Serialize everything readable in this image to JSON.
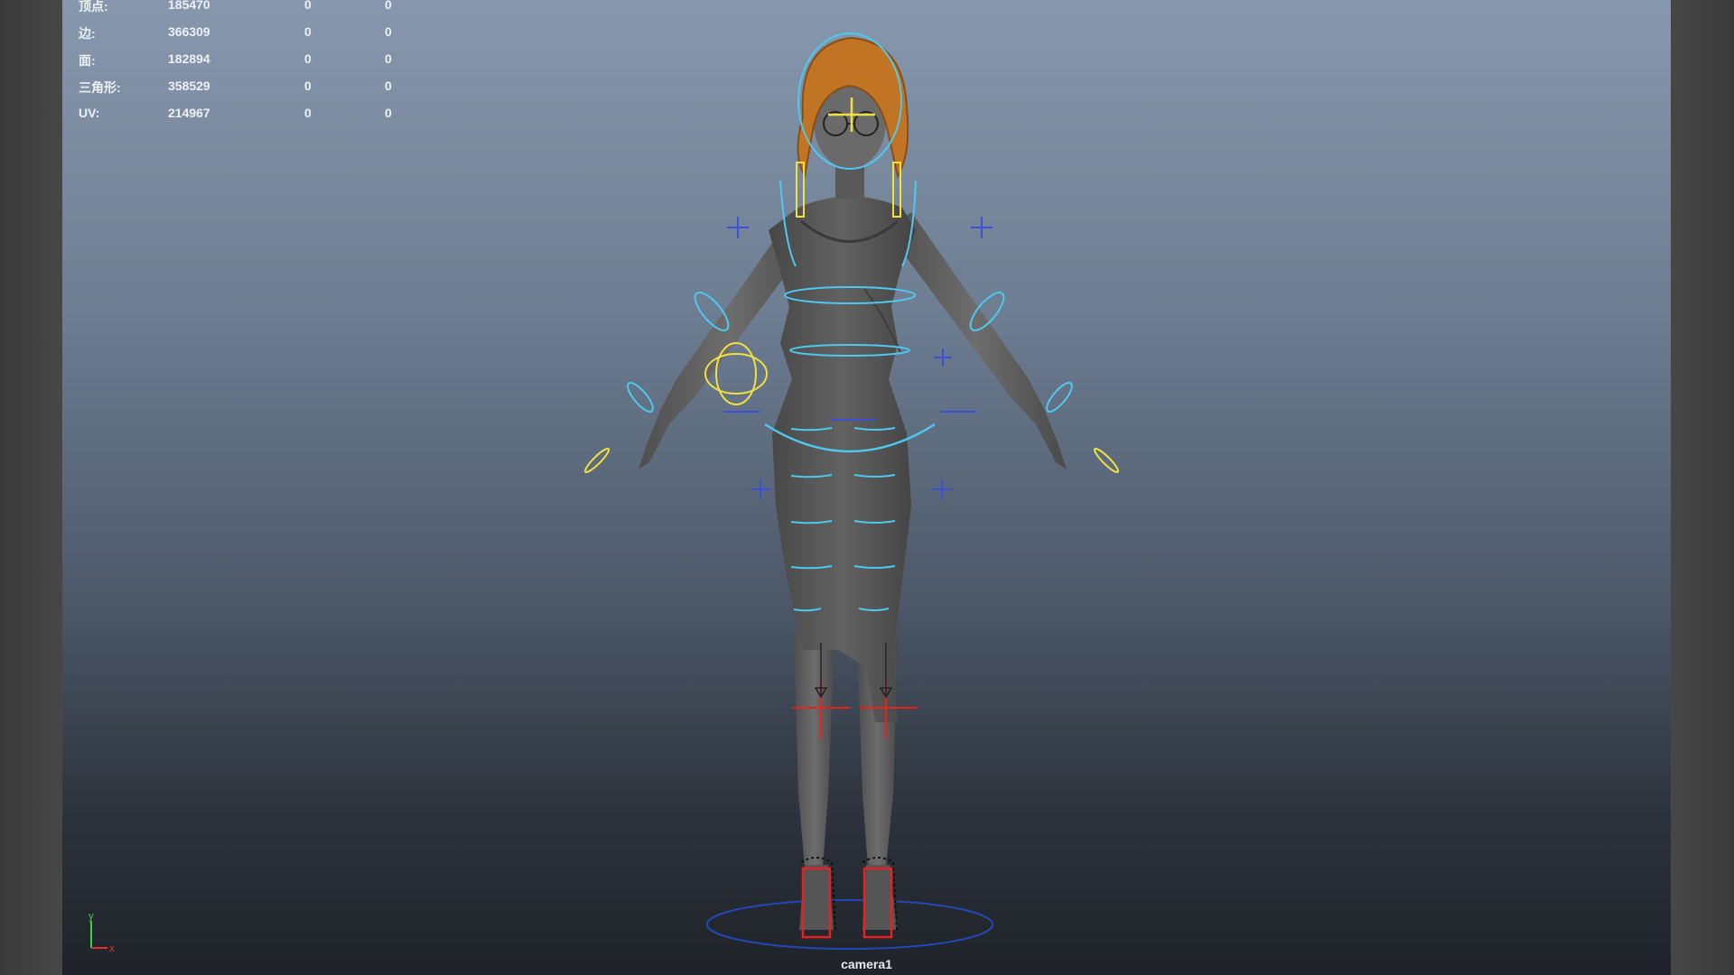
{
  "app": {
    "viewport_name": "persp-viewport"
  },
  "hud": {
    "rows": [
      {
        "label": "顶点:",
        "total": "185470",
        "selected": "0",
        "triangles": "0"
      },
      {
        "label": "边:",
        "total": "366309",
        "selected": "0",
        "triangles": "0"
      },
      {
        "label": "面:",
        "total": "182894",
        "selected": "0",
        "triangles": "0"
      },
      {
        "label": "三角形:",
        "total": "358529",
        "selected": "0",
        "triangles": "0"
      },
      {
        "label": "UV:",
        "total": "214967",
        "selected": "0",
        "triangles": "0"
      }
    ]
  },
  "camera": {
    "name": "camera1"
  },
  "axis": {
    "y_label": "y",
    "x_label": "x"
  },
  "colors": {
    "rig_cyan": "#4fc8ee",
    "rig_yellow": "#f0e040",
    "rig_blue": "#3b4fd8",
    "rig_red": "#e82020",
    "hair": "#c87828",
    "body_grey": "#5f5f5f"
  }
}
